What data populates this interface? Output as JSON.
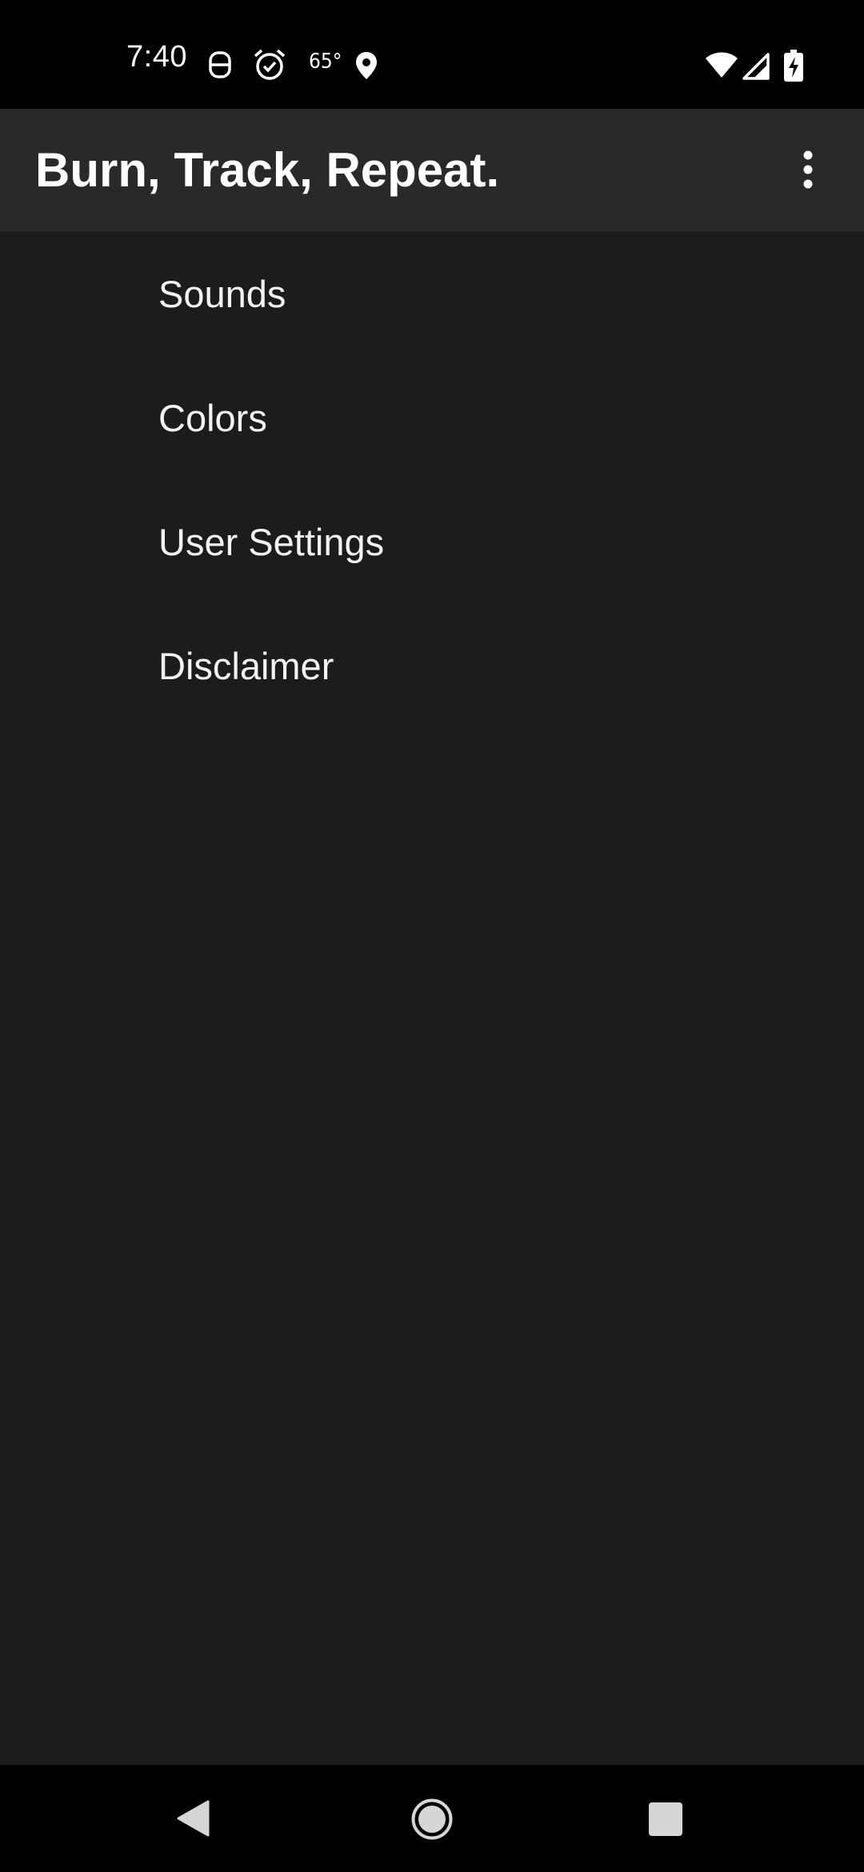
{
  "status_bar": {
    "time": "7:40",
    "temperature": "65°",
    "icons": [
      "notification-app-icon",
      "alarm-clock-icon",
      "location-pin-icon",
      "wifi-icon",
      "cellular-signal-icon",
      "battery-charging-icon"
    ]
  },
  "app_bar": {
    "title": "Burn, Track, Repeat.",
    "overflow_icon": "more-vert-icon"
  },
  "menu": {
    "items": [
      {
        "label": "Sounds"
      },
      {
        "label": "Colors"
      },
      {
        "label": "User Settings"
      },
      {
        "label": "Disclaimer"
      }
    ]
  },
  "nav_bar": {
    "icons": [
      "back-icon",
      "home-icon",
      "recents-icon"
    ]
  },
  "colors": {
    "background": "#1c1c1c",
    "app_bar": "#29292b",
    "status_bar": "#000000",
    "text": "#ffffff"
  }
}
